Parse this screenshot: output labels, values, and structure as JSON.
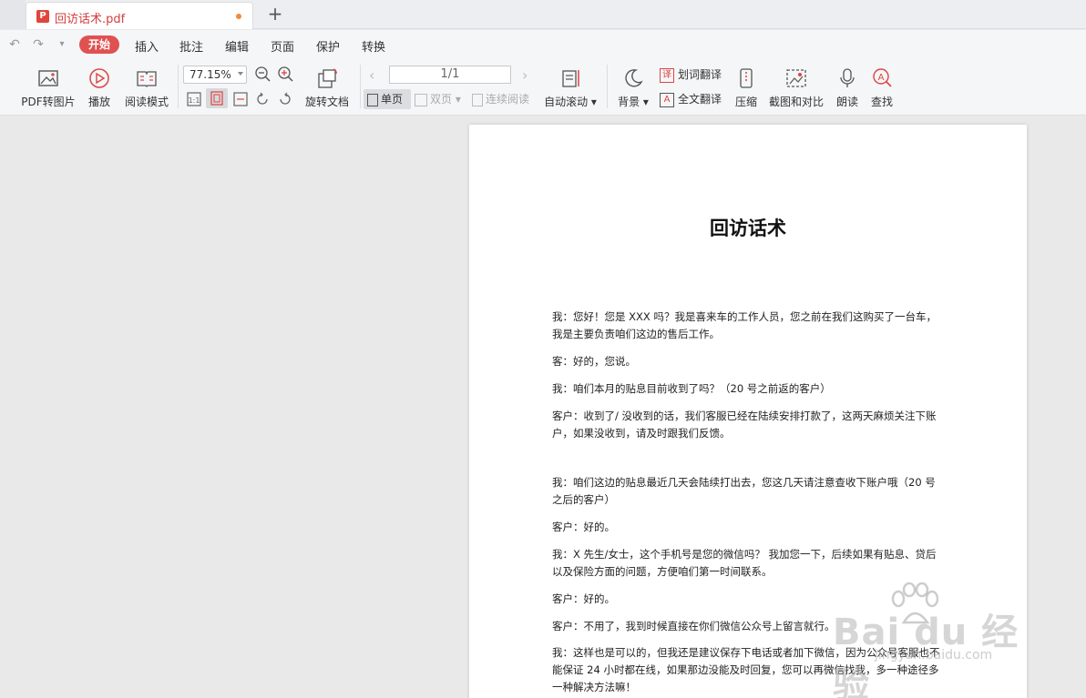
{
  "tab": {
    "title": "回访话术.pdf",
    "new_tab": "+"
  },
  "menu": {
    "active": "开始",
    "items": [
      "插入",
      "批注",
      "编辑",
      "页面",
      "保护",
      "转换"
    ]
  },
  "toolbar": {
    "pdf_to_image": "PDF转图片",
    "play": "播放",
    "read_mode": "阅读模式",
    "zoom": "77.15%",
    "rotate": "旋转文档",
    "page_indicator": "1/1",
    "single_page": "单页",
    "double_page": "双页",
    "continuous": "连续阅读",
    "auto_scroll": "自动滚动",
    "background": "背景",
    "word_translate": "划词翻译",
    "full_translate": "全文翻译",
    "compress": "压缩",
    "screenshot_compare": "截图和对比",
    "read_aloud": "朗读",
    "find": "查找"
  },
  "document": {
    "title": "回访话术",
    "paragraphs": [
      "我：您好！您是 XXX 吗？我是喜来车的工作人员，您之前在我们这购买了一台车，我是主要负责咱们这边的售后工作。",
      "客：好的，您说。",
      "我：咱们本月的贴息目前收到了吗？（20 号之前返的客户）",
      "客户：收到了/ 没收到的话，我们客服已经在陆续安排打款了，这两天麻烦关注下账户，如果没收到，请及时跟我们反馈。",
      " 我：咱们这边的贴息最近几天会陆续打出去，您这几天请注意查收下账户哦（20 号之后的客户）",
      "客户：好的。",
      "我：X 先生/女士，这个手机号是您的微信吗？ 我加您一下，后续如果有贴息、贷后以及保险方面的问题，方便咱们第一时间联系。",
      "客户：好的。",
      " 客户：不用了，我到时候直接在你们微信公众号上留言就行。",
      "我：这样也是可以的，但我还是建议保存下电话或者加下微信，因为公众号客服也不能保证 24 小时都在线，如果那边没能及时回复，您可以再微信找我，多一种途径多一种解决方法嘛！"
    ]
  },
  "watermark": {
    "text": "Bai du 经验",
    "sub": "jingyan.baidu.com"
  }
}
